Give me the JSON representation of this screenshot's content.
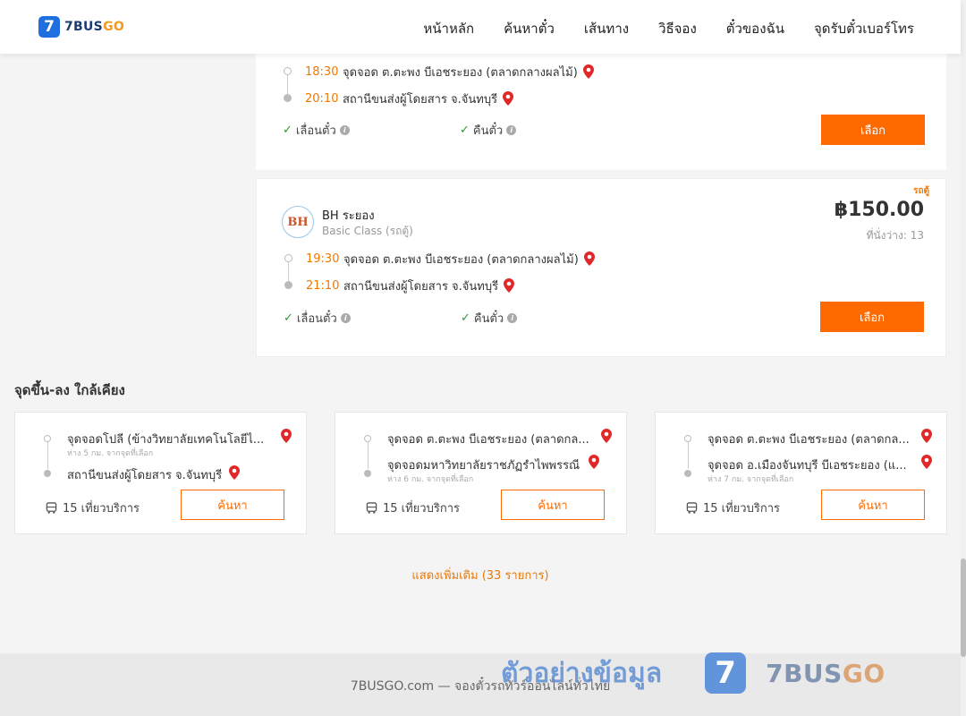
{
  "header": {
    "logo_mark": "7",
    "logo_text_a": "7BUS",
    "logo_text_b": "GO",
    "nav": [
      "หน้าหลัก",
      "ค้นหาตั๋ว",
      "เส้นทาง",
      "วิธีจอง",
      "ตั๋วของฉัน",
      "จุดรับตั๋วเบอร์โทร"
    ]
  },
  "trip_cards": [
    {
      "depart_time": "18:30",
      "depart_stop": "จุดจอด ต.ตะพง บีเอชระยอง (ตลาดกลางผลไม้)",
      "arrive_time": "20:10",
      "arrive_stop": "สถานีขนส่งผู้โดยสาร จ.จันทบุรี",
      "perk_change": "เลื่อนตั๋ว",
      "perk_refund": "คืนตั๋ว",
      "select_label": "เลือก"
    },
    {
      "tag": "รถตู้",
      "operator_logo": "BH",
      "operator": "BH ระยอง",
      "class": "Basic Class (รถตู้)",
      "price": "฿150.00",
      "seats": "ที่นั่งว่าง: 13",
      "depart_time": "19:30",
      "depart_stop": "จุดจอด ต.ตะพง บีเอชระยอง (ตลาดกลางผลไม้)",
      "arrive_time": "21:10",
      "arrive_stop": "สถานีขนส่งผู้โดยสาร จ.จันทบุรี",
      "perk_change": "เลื่อนตั๋ว",
      "perk_refund": "คืนตั๋ว",
      "select_label": "เลือก"
    }
  ],
  "nearby": {
    "title": "จุดขึ้น-ลง ใกล้เคียง",
    "cards": [
      {
        "from": "จุดจอดโปลี (ข้างวิทยาลัยเทคโนโลยีไ...",
        "from_note": "ห่าง 5 กม. จากจุดที่เลือก",
        "to": "สถานีขนส่งผู้โดยสาร จ.จันทบุรี",
        "to_note": "",
        "trips": "15 เที่ยวบริการ",
        "search_label": "ค้นหา"
      },
      {
        "from": "จุดจอด ต.ตะพง บีเอชระยอง (ตลาดกล...",
        "from_note": "",
        "to": "จุดจอดมหาวิทยาลัยราชภัฏรำไพพรรณี",
        "to_note": "ห่าง 6 กม. จากจุดที่เลือก",
        "trips": "15 เที่ยวบริการ",
        "search_label": "ค้นหา"
      },
      {
        "from": "จุดจอด ต.ตะพง บีเอชระยอง (ตลาดกล...",
        "from_note": "",
        "to": "จุดจอด อ.เมืองจันทบุรี บีเอชระยอง (แ...",
        "to_note": "ห่าง 7 กม. จากจุดที่เลือก",
        "trips": "15 เที่ยวบริการ",
        "search_label": "ค้นหา"
      }
    ],
    "show_more": "แสดงเพิ่มเติม (33 รายการ)"
  },
  "footer": {
    "text": "7BUSGO.com — จองตั๋วรถทัวร์ออนไลน์ทั่วไทย"
  },
  "watermark": {
    "text": "ตัวอย่างข้อมูล",
    "mark": "7",
    "brand_a": "7BUS",
    "brand_b": "GO"
  },
  "colors": {
    "accent": "#ff6a00",
    "time": "#f07800",
    "check": "#2a9d3a",
    "pin": "#e02828"
  },
  "icons": [
    "pin-icon",
    "check-icon",
    "info-icon",
    "bus-icon"
  ]
}
